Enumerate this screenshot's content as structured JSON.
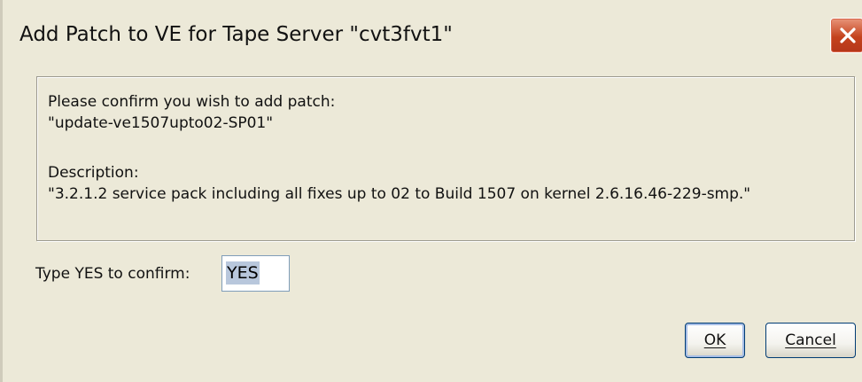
{
  "window": {
    "title": "Add Patch to VE for Tape Server \"cvt3fvt1\"",
    "close_icon": "close-icon"
  },
  "message": {
    "line1": "Please confirm you wish to add patch:",
    "line2": "\"update-ve1507upto02-SP01\"",
    "line3": "Description:",
    "line4": "\"3.2.1.2 service pack including all fixes up to 02 to Build 1507 on kernel 2.6.16.46-229-smp.\""
  },
  "confirm": {
    "label": "Type YES to confirm:",
    "value": "YES"
  },
  "buttons": {
    "ok_label": "OK",
    "cancel_label": "Cancel"
  },
  "colors": {
    "dialog_bg": "#ece9d8",
    "close_red": "#c4421d",
    "button_border": "#003c74",
    "selection": "#b8c7dc"
  }
}
